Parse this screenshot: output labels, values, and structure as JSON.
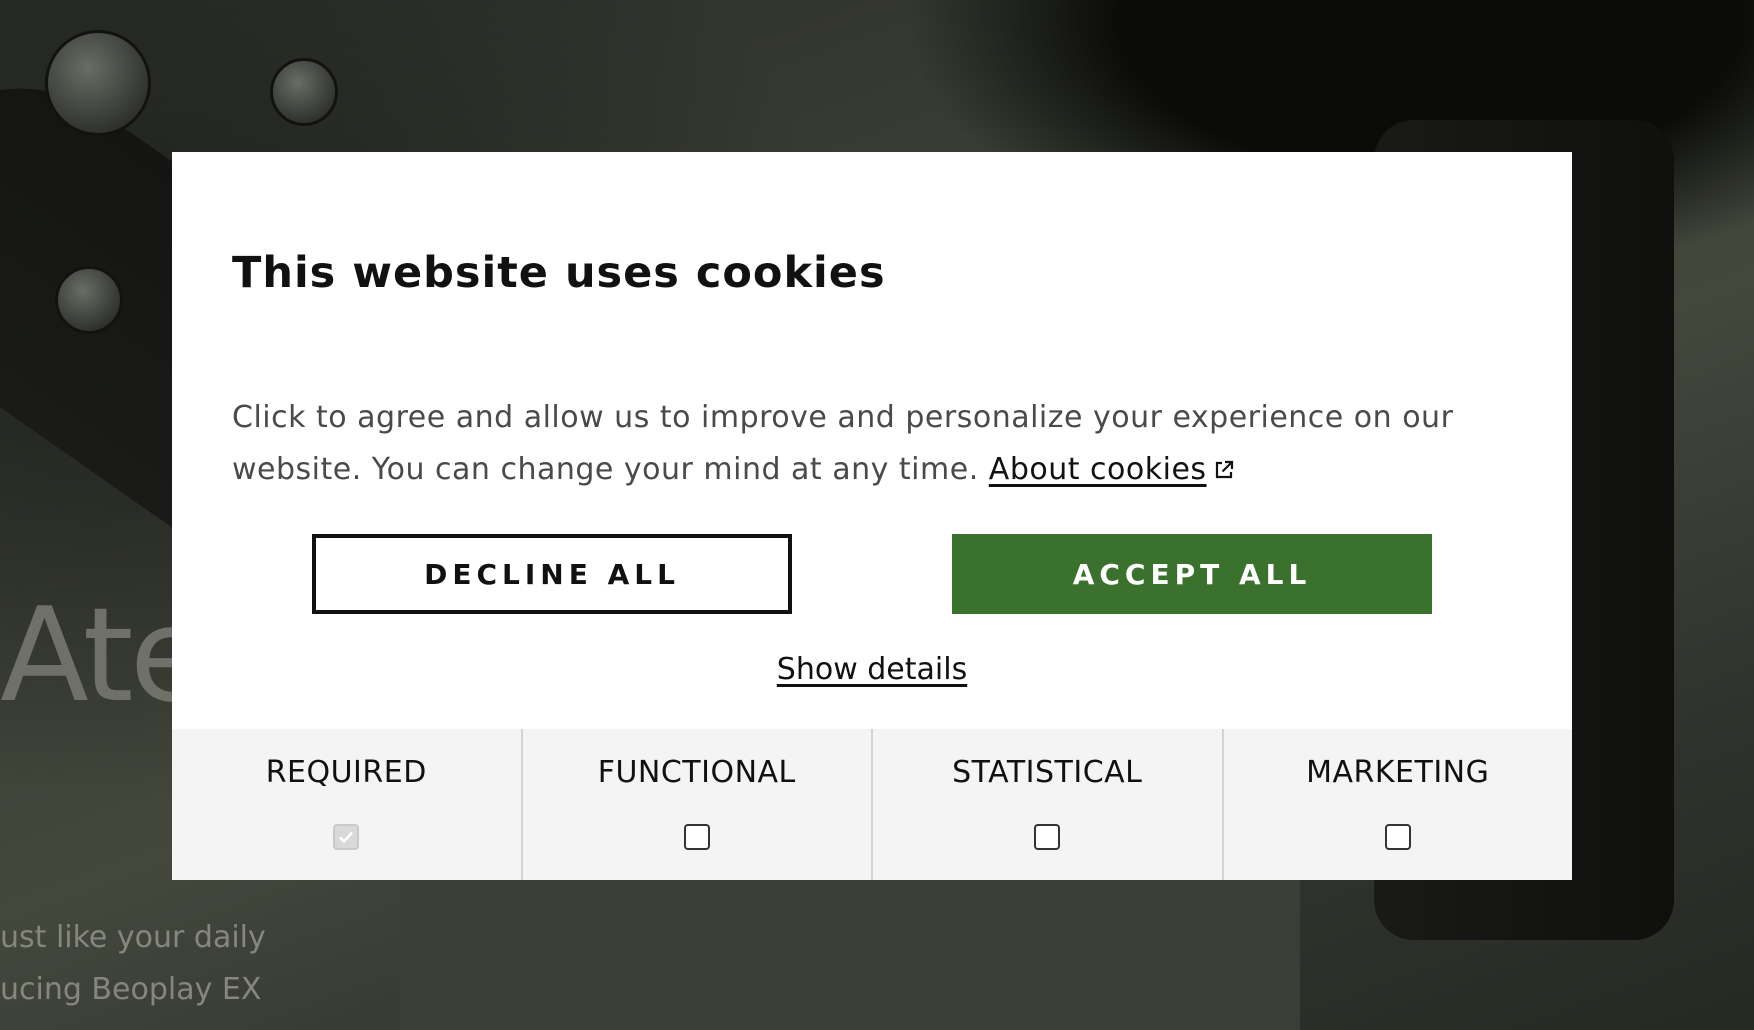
{
  "background": {
    "heading": "Ate",
    "lines": [
      "ust like your daily",
      "ucing Beoplay EX"
    ]
  },
  "dialog": {
    "title": "This website uses cookies",
    "body": "Click to agree and allow us to improve and personalize your experience on our website. You can change your mind at any time.",
    "about_link": "About cookies",
    "decline_label": "DECLINE ALL",
    "accept_label": "ACCEPT ALL",
    "show_details_label": "Show details",
    "accent_color": "#3a722d",
    "categories": [
      {
        "label": "REQUIRED",
        "checked": true,
        "disabled": true
      },
      {
        "label": "FUNCTIONAL",
        "checked": false,
        "disabled": false
      },
      {
        "label": "STATISTICAL",
        "checked": false,
        "disabled": false
      },
      {
        "label": "MARKETING",
        "checked": false,
        "disabled": false
      }
    ]
  }
}
